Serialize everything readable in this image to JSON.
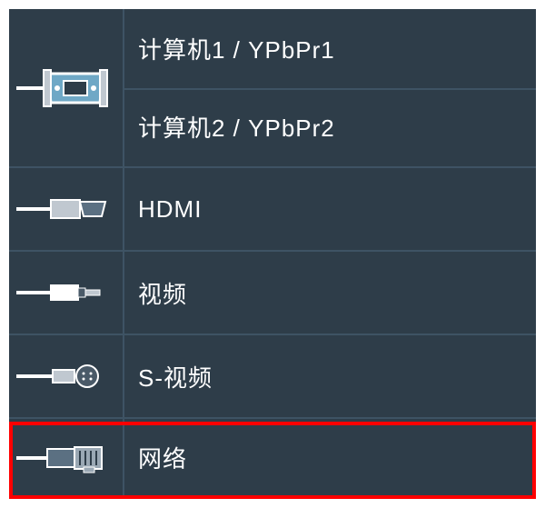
{
  "menu": {
    "computer1_label": "计算机1 / YPbPr1",
    "computer2_label": "计算机2 / YPbPr2",
    "hdmi_label": "HDMI",
    "video_label": "视频",
    "svideo_label": "S-视频",
    "network_label": "网络"
  },
  "icons": {
    "computer": "vga-connector-icon",
    "hdmi": "hdmi-connector-icon",
    "video": "rca-connector-icon",
    "svideo": "svideo-connector-icon",
    "network": "ethernet-connector-icon"
  },
  "highlight": {
    "target": "network",
    "color": "#ff0000"
  }
}
